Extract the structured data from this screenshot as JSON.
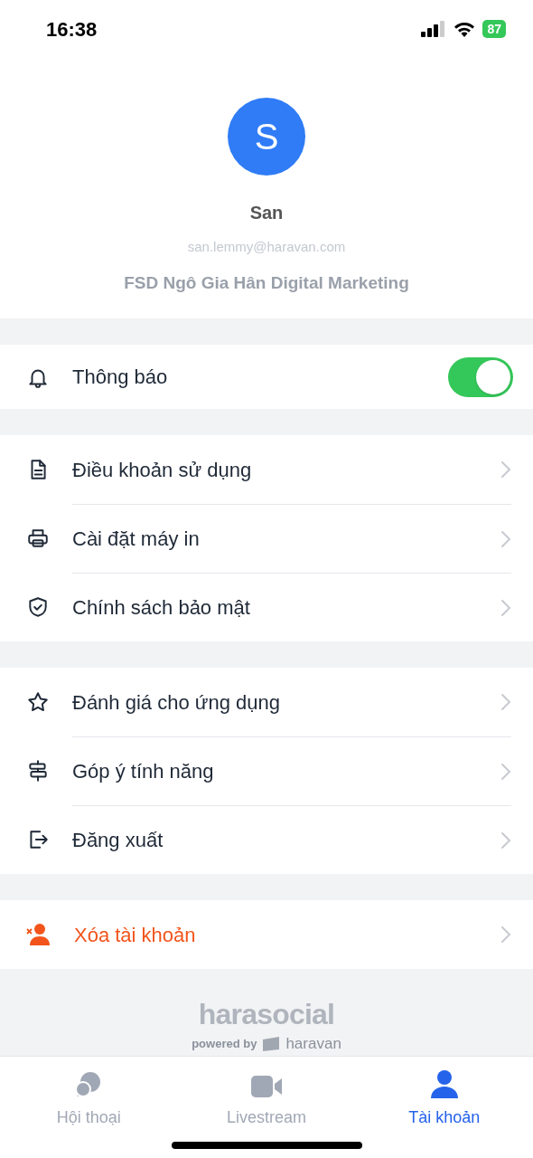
{
  "status_bar": {
    "time": "16:38",
    "battery": "87"
  },
  "profile": {
    "avatar_letter": "S",
    "name": "San",
    "email": "san.lemmy@haravan.com",
    "organization": "FSD Ngô Gia Hân Digital Marketing"
  },
  "notification": {
    "label": "Thông báo",
    "on": true
  },
  "groups": [
    {
      "items": [
        {
          "label": "Điều khoản sử dụng",
          "kind": "normal"
        },
        {
          "label": "Cài đặt máy in",
          "kind": "normal"
        },
        {
          "label": "Chính sách bảo mật",
          "kind": "normal"
        }
      ]
    },
    {
      "items": [
        {
          "label": "Đánh giá cho ứng dụng",
          "kind": "normal"
        },
        {
          "label": "Góp ý tính năng",
          "kind": "normal"
        },
        {
          "label": "Đăng xuất",
          "kind": "normal"
        }
      ]
    },
    {
      "items": [
        {
          "label": "Xóa tài khoản",
          "kind": "danger"
        }
      ]
    }
  ],
  "branding": {
    "logo": "harasocial",
    "powered_by": "powered by",
    "company": "haravan"
  },
  "tab_bar": [
    {
      "label": "Hội thoại",
      "selected": false
    },
    {
      "label": "Livestream",
      "selected": false
    },
    {
      "label": "Tài khoản",
      "selected": true
    }
  ]
}
